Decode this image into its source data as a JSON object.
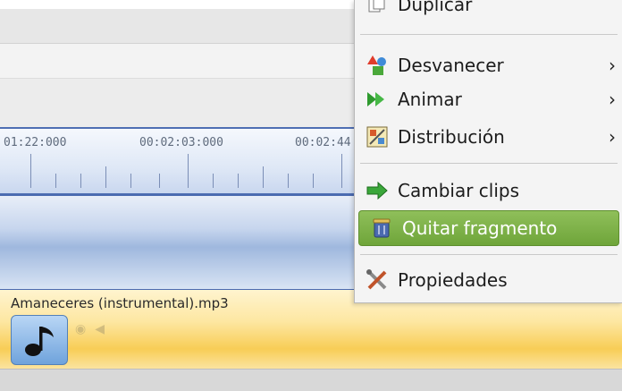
{
  "menu": {
    "items": [
      {
        "label": "Duplicar",
        "icon": "duplicate-icon",
        "submenu": false
      },
      {
        "label": "Desvanecer",
        "icon": "fade-icon",
        "submenu": true
      },
      {
        "label": "Animar",
        "icon": "animate-icon",
        "submenu": true
      },
      {
        "label": "Distribución",
        "icon": "distribution-icon",
        "submenu": true
      },
      {
        "label": "Cambiar clips",
        "icon": "swap-clips-icon",
        "submenu": false
      },
      {
        "label": "Quitar fragmento",
        "icon": "trash-icon",
        "submenu": false,
        "highlighted": true
      },
      {
        "label": "Propiedades",
        "icon": "tools-icon",
        "submenu": false
      }
    ],
    "submenu_arrow": "›"
  },
  "timeline": {
    "ticks": [
      "01:22:000",
      "00:02:03:000",
      "00:02:44"
    ]
  },
  "audio_track": {
    "filename": "Amaneceres (instrumental).mp3",
    "icon": "music-note-icon"
  },
  "colors": {
    "highlight": "#7cb046",
    "ruler_border": "#4f6fb3",
    "audio_strip": "#f8cd56"
  }
}
